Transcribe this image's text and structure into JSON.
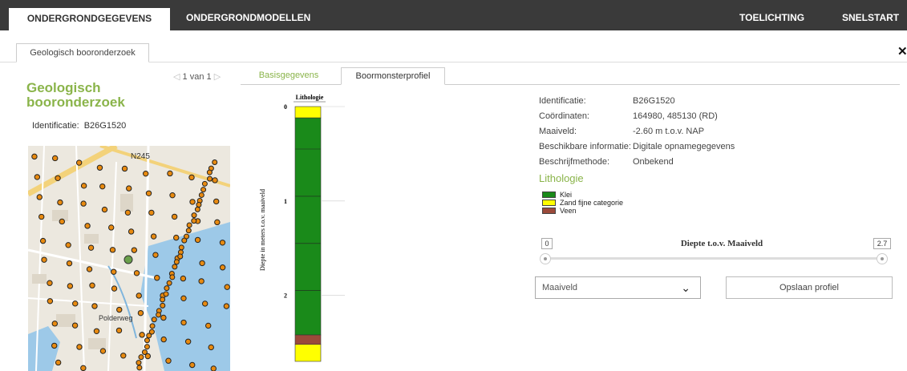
{
  "topnav": {
    "ondergrondgegevens": "ONDERGRONDGEGEVENS",
    "ondergrondmodellen": "ONDERGRONDMODELLEN",
    "toelichting": "TOELICHTING",
    "snelstart": "SNELSTART"
  },
  "outer_tab": "Geologisch booronderzoek",
  "close_glyph": "✕",
  "pager": {
    "prev": "◁",
    "text": "1 van 1",
    "next": "▷"
  },
  "sidebar": {
    "title_line1": "Geologisch",
    "title_line2": "booronderzoek",
    "ident_label": "Identificatie:",
    "ident_value": "B26G1520"
  },
  "map": {
    "label_n": "N245",
    "label_polder": "Polderweg"
  },
  "tabs": {
    "basisgegevens": "Basisgegevens",
    "boormonsterprofiel": "Boormonsterprofiel"
  },
  "chart_data": {
    "type": "bar",
    "title": "Lithologie",
    "ylabel": "Diepte in meters t.o.v. maaiveld",
    "ylim": [
      0,
      2.7
    ],
    "ticks": [
      "0",
      "1",
      "2"
    ],
    "layers": [
      {
        "top": 0.0,
        "bottom": 0.12,
        "name": "Zand fijne categorie",
        "color": "#ffff00"
      },
      {
        "top": 0.12,
        "bottom": 2.42,
        "name": "Klei",
        "color": "#1a8a1a"
      },
      {
        "top": 2.42,
        "bottom": 2.52,
        "name": "Veen",
        "color": "#9b4a3a"
      },
      {
        "top": 2.52,
        "bottom": 2.7,
        "name": "Zand fijne categorie",
        "color": "#ffff00"
      }
    ]
  },
  "info": {
    "rows": [
      {
        "k": "Identificatie:",
        "v": "B26G1520"
      },
      {
        "k": "Coördinaten:",
        "v": "164980, 485130 (RD)"
      },
      {
        "k": "Maaiveld:",
        "v": "-2.60 m t.o.v. NAP"
      },
      {
        "k": "Beschikbare informatie:",
        "v": "Digitale opnamegegevens"
      },
      {
        "k": "Beschrijfmethode:",
        "v": "Onbekend"
      }
    ]
  },
  "lithologie_heading": "Lithologie",
  "legend": [
    {
      "label": "Klei",
      "color": "#1a8a1a"
    },
    {
      "label": "Zand fijne categorie",
      "color": "#ffff00"
    },
    {
      "label": "Veen",
      "color": "#9b4a3a"
    }
  ],
  "slider": {
    "min": "0",
    "max": "2.7",
    "label": "Diepte t.o.v. Maaiveld"
  },
  "select": {
    "value": "Maaiveld",
    "chevron": "⌄"
  },
  "save_button": "Opslaan profiel"
}
